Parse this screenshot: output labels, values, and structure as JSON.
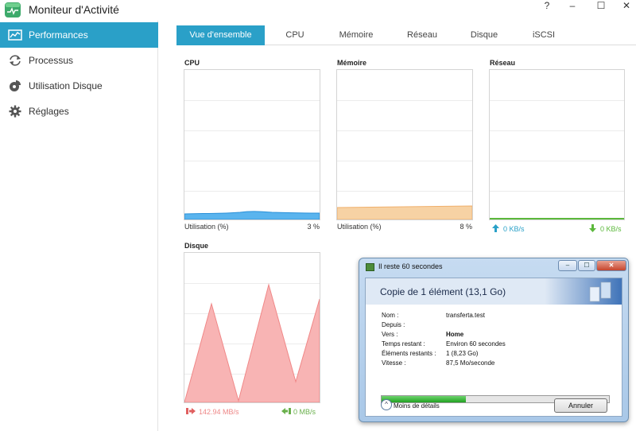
{
  "window": {
    "title": "Moniteur d'Activité",
    "controls": [
      "?",
      "–",
      "☐",
      "✕"
    ]
  },
  "sidebar": {
    "items": [
      {
        "label": "Performances",
        "icon": "performance-chart-icon",
        "active": true
      },
      {
        "label": "Processus",
        "icon": "refresh-arrows-icon",
        "active": false
      },
      {
        "label": "Utilisation Disque",
        "icon": "disk-pie-icon",
        "active": false
      },
      {
        "label": "Réglages",
        "icon": "gear-icon",
        "active": false
      }
    ]
  },
  "tabs": [
    {
      "label": "Vue d'ensemble",
      "active": true
    },
    {
      "label": "CPU",
      "active": false
    },
    {
      "label": "Mémoire",
      "active": false
    },
    {
      "label": "Réseau",
      "active": false
    },
    {
      "label": "Disque",
      "active": false
    },
    {
      "label": "iSCSI",
      "active": false
    }
  ],
  "panels": {
    "cpu": {
      "title": "CPU",
      "usage_label": "Utilisation (%)",
      "usage_value": "3 %",
      "color": "#2aa0e8"
    },
    "memory": {
      "title": "Mémoire",
      "usage_label": "Utilisation (%)",
      "usage_value": "8 %",
      "color": "#f3b672"
    },
    "network": {
      "title": "Réseau",
      "upload": "0 KB/s",
      "download": "0 KB/s",
      "color": "#5cb83c"
    },
    "disk": {
      "title": "Disque",
      "read": "142.94 MB/s",
      "write": "0 MB/s",
      "color": "#f08080"
    }
  },
  "copy_dialog": {
    "title": "Il reste 60 secondes",
    "heading": "Copie de 1 élément (13,1 Go)",
    "fields": [
      {
        "label": "Nom :",
        "value": "transferta.test"
      },
      {
        "label": "Depuis :",
        "value": ""
      },
      {
        "label": "Vers :",
        "value": "Home"
      },
      {
        "label": "Temps restant :",
        "value": "Environ 60 secondes"
      },
      {
        "label": "Éléments restants :",
        "value": "1 (8,23 Go)"
      },
      {
        "label": "Vitesse :",
        "value": "87,5 Mo/seconde"
      }
    ],
    "progress": 0.37,
    "more_details": "Moins de détails",
    "cancel": "Annuler"
  }
}
